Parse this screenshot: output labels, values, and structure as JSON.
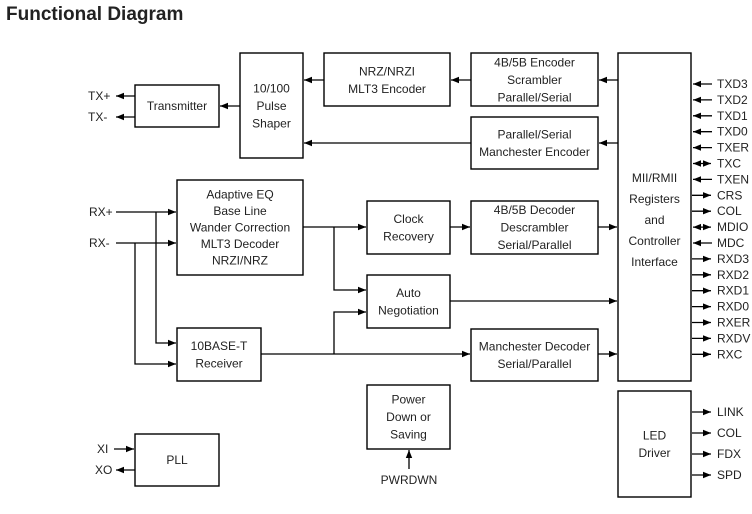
{
  "title": "Functional Diagram",
  "blocks": {
    "transmitter": [
      "Transmitter"
    ],
    "pulse_shaper": [
      "10/100",
      "Pulse",
      "Shaper"
    ],
    "mlt3_encoder": [
      "NRZ/NRZI",
      "MLT3 Encoder"
    ],
    "encoder_4b5b": [
      "4B/5B Encoder",
      "Scrambler",
      "Parallel/Serial"
    ],
    "manchester_encoder": [
      "Parallel/Serial",
      "Manchester Encoder"
    ],
    "mii_interface": [
      "MII/RMII",
      "Registers",
      "and",
      "Controller",
      "Interface"
    ],
    "adaptive_eq": [
      "Adaptive EQ",
      "Base Line",
      "Wander Correction",
      "MLT3 Decoder",
      "NRZI/NRZ"
    ],
    "clock_recovery": [
      "Clock",
      "Recovery"
    ],
    "decoder_4b5b": [
      "4B/5B Decoder",
      "Descrambler",
      "Serial/Parallel"
    ],
    "auto_negotiation": [
      "Auto",
      "Negotiation"
    ],
    "receiver_10baset": [
      "10BASE-T",
      "Receiver"
    ],
    "manchester_decoder": [
      "Manchester Decoder",
      "Serial/Parallel"
    ],
    "power_down": [
      "Power",
      "Down or",
      "Saving"
    ],
    "pll": [
      "PLL"
    ],
    "led_driver": [
      "LED",
      "Driver"
    ]
  },
  "pins": {
    "tx_plus": "TX+",
    "tx_minus": "TX-",
    "rx_plus": "RX+",
    "rx_minus": "RX-",
    "xi": "XI",
    "xo": "XO",
    "pwrdwn": "PWRDWN",
    "mii": [
      {
        "name": "TXD3",
        "dir": "in"
      },
      {
        "name": "TXD2",
        "dir": "in"
      },
      {
        "name": "TXD1",
        "dir": "in"
      },
      {
        "name": "TXD0",
        "dir": "in"
      },
      {
        "name": "TXER",
        "dir": "in"
      },
      {
        "name": "TXC",
        "dir": "bi"
      },
      {
        "name": "TXEN",
        "dir": "in"
      },
      {
        "name": "CRS",
        "dir": "out"
      },
      {
        "name": "COL",
        "dir": "out"
      },
      {
        "name": "MDIO",
        "dir": "bi"
      },
      {
        "name": "MDC",
        "dir": "in"
      },
      {
        "name": "RXD3",
        "dir": "out"
      },
      {
        "name": "RXD2",
        "dir": "out"
      },
      {
        "name": "RXD1",
        "dir": "out"
      },
      {
        "name": "RXD0",
        "dir": "out"
      },
      {
        "name": "RXER",
        "dir": "out"
      },
      {
        "name": "RXDV",
        "dir": "out"
      },
      {
        "name": "RXC",
        "dir": "out"
      }
    ],
    "led": [
      {
        "name": "LINK",
        "dir": "out"
      },
      {
        "name": "COL",
        "dir": "out"
      },
      {
        "name": "FDX",
        "dir": "out"
      },
      {
        "name": "SPD",
        "dir": "out"
      }
    ]
  }
}
